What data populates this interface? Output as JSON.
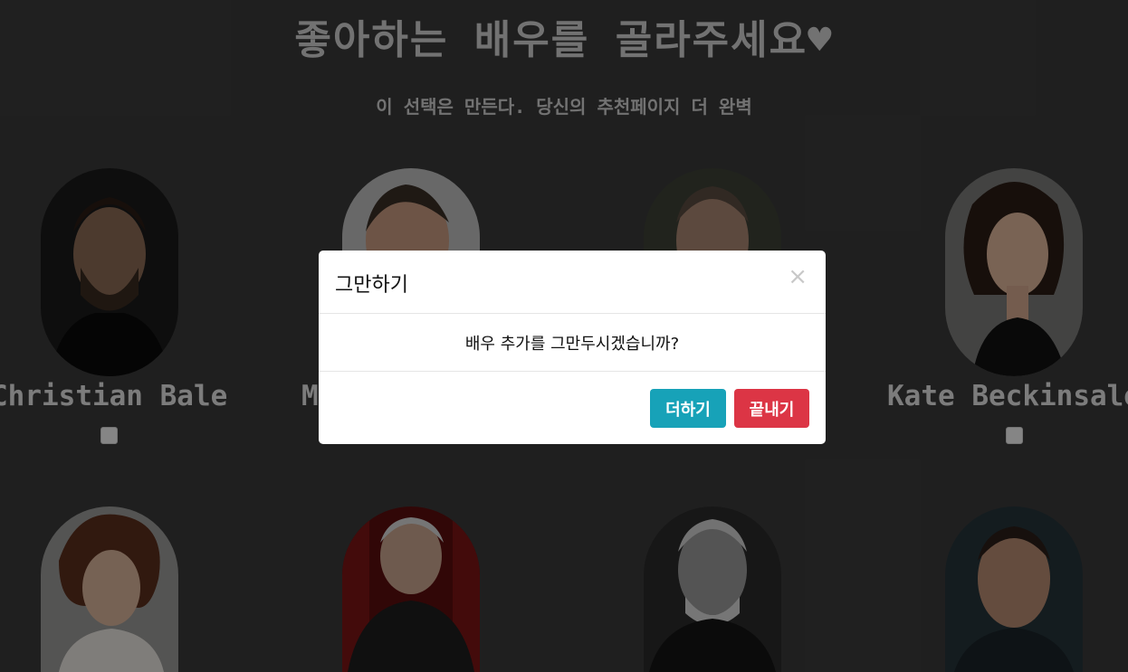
{
  "page": {
    "title": "좋아하는 배우를 골라주세요♥",
    "subtitle": "이 선택은 만든다. 당신의 추천페이지 더 완벽"
  },
  "actors": [
    {
      "name": "Christian Bale"
    },
    {
      "name": "M"
    },
    {
      "name": ""
    },
    {
      "name": "Kate Beckinsale"
    }
  ],
  "modal": {
    "title": "그만하기",
    "close_symbol": "×",
    "message": "배우 추가를 그만두시겠습니까?",
    "add_label": "더하기",
    "end_label": "끝내기"
  },
  "colors": {
    "add_button": "#17a2b8",
    "end_button": "#dc3545",
    "overlay": "#000000"
  }
}
